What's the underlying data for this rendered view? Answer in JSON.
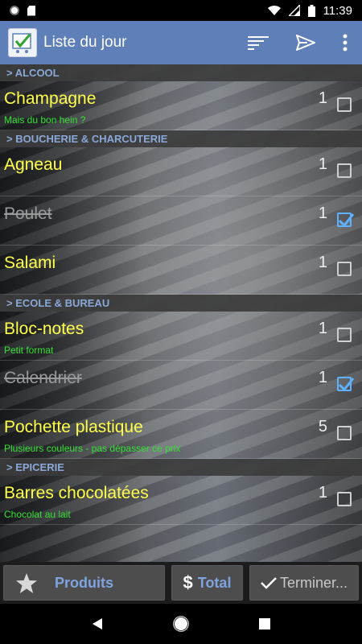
{
  "status": {
    "time": "11:39"
  },
  "appbar": {
    "title": "Liste du jour"
  },
  "categories": [
    {
      "label": "> ALCOOL"
    },
    {
      "label": "> BOUCHERIE & CHARCUTERIE"
    },
    {
      "label": "> ECOLE & BUREAU"
    },
    {
      "label": "> EPICERIE"
    }
  ],
  "items": [
    {
      "name": "Champagne",
      "note": "Mais du bon hein ?",
      "qty": "1",
      "checked": false
    },
    {
      "name": "Agneau",
      "note": "",
      "qty": "1",
      "checked": false
    },
    {
      "name": "Poulet",
      "note": "",
      "qty": "1",
      "checked": true
    },
    {
      "name": "Salami",
      "note": "",
      "qty": "1",
      "checked": false
    },
    {
      "name": "Bloc-notes",
      "note": "Petit format",
      "qty": "1",
      "checked": false
    },
    {
      "name": "Calendrier",
      "note": "",
      "qty": "1",
      "checked": true
    },
    {
      "name": "Pochette plastique",
      "note": "Plusieurs couleurs - pas dépasser ce prix",
      "qty": "5",
      "checked": false
    },
    {
      "name": "Barres chocolatées",
      "note": "Chocolat au lait",
      "qty": "1",
      "checked": false
    }
  ],
  "bottom": {
    "produits_label": "Produits",
    "total_symbol": "$",
    "total_label": "Total",
    "terminer_label": "Terminer..."
  },
  "colors": {
    "appbar": "#5e7fb7",
    "item_name": "#ffff4a",
    "note": "#35e035",
    "category_text": "#8aa8d8",
    "checkbox_checked": "#5fb0ff"
  },
  "icons": {
    "sort": "sort-icon",
    "send": "send-icon",
    "menu": "more-vert-icon",
    "star": "star-icon",
    "check": "check-icon"
  }
}
